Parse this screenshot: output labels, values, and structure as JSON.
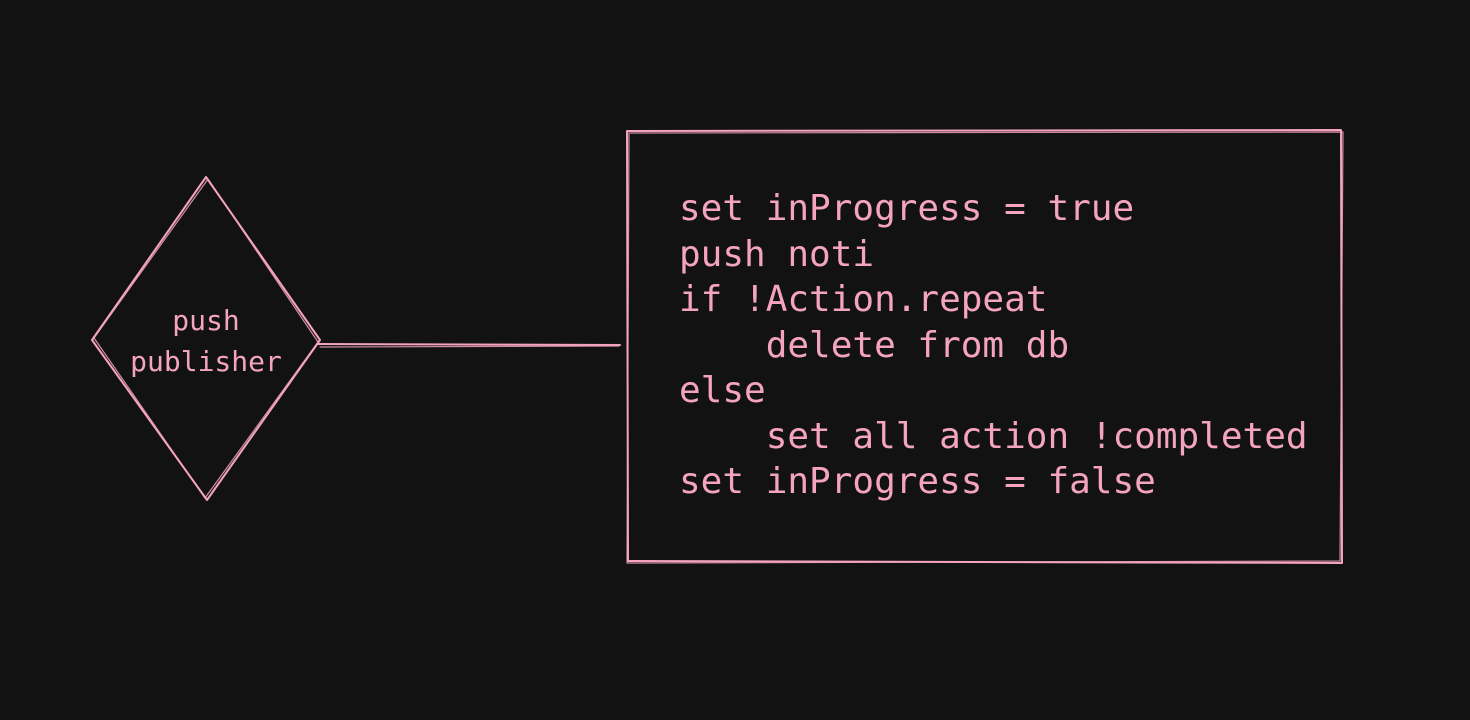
{
  "colors": {
    "background": "#121212",
    "stroke": "#f4a3c0",
    "text": "#f4a3c0"
  },
  "decision": {
    "label_lines": [
      "push",
      "publisher"
    ]
  },
  "process": {
    "code_lines": [
      "set inProgress = true",
      "push noti",
      "if !Action.repeat",
      "    delete from db",
      "else",
      "    set all action !completed",
      "set inProgress = false"
    ]
  }
}
